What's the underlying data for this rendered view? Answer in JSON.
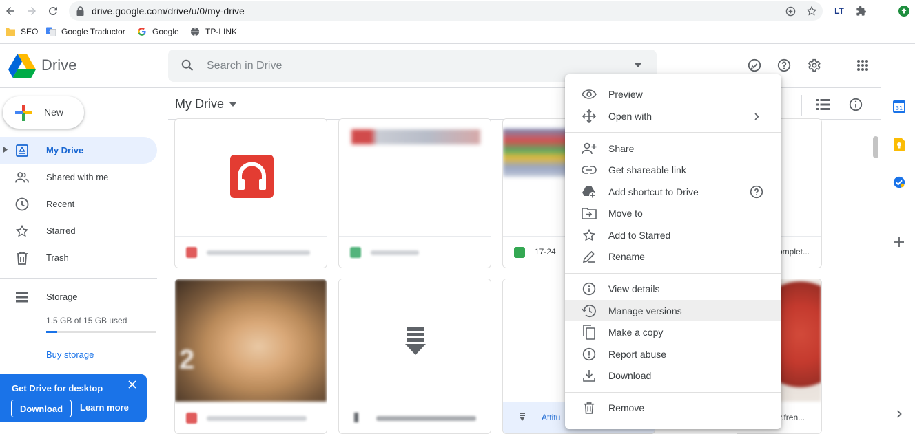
{
  "browser": {
    "url": "drive.google.com/drive/u/0/my-drive",
    "extension_badge": "LT",
    "bookmarks": [
      "SEO",
      "Google Traductor",
      "Google",
      "TP-LINK"
    ]
  },
  "header": {
    "app_name": "Drive",
    "search_placeholder": "Search in Drive"
  },
  "sidebar": {
    "new_label": "New",
    "items": [
      {
        "label": "My Drive",
        "active": true
      },
      {
        "label": "Shared with me"
      },
      {
        "label": "Recent"
      },
      {
        "label": "Starred"
      },
      {
        "label": "Trash"
      }
    ],
    "storage_label": "Storage",
    "storage_used": "1.5 GB of 15 GB used",
    "storage_fraction": 0.1,
    "buy_storage": "Buy storage"
  },
  "promo": {
    "title": "Get Drive for desktop",
    "download": "Download",
    "learn_more": "Learn more"
  },
  "main": {
    "title": "My Drive",
    "files_row1": [
      {
        "name": "",
        "icon_color": "#e05c5c"
      },
      {
        "name": "",
        "icon_color": "#53b47c"
      },
      {
        "name": "17-24",
        "icon_color": "#34a853"
      },
      {
        "name": "omplet...",
        "icon_color": ""
      }
    ],
    "files_row2": [
      {
        "name": "",
        "icon_color": "#e05c5c"
      },
      {
        "name": "",
        "icon_color": ""
      },
      {
        "name": "Attitu",
        "icon_color": ""
      },
      {
        "name": "v.fren...",
        "icon_color": ""
      }
    ]
  },
  "context_menu": {
    "items": [
      {
        "label": "Preview",
        "icon": "eye-icon"
      },
      {
        "label": "Open with",
        "icon": "move-arrows-icon"
      },
      {
        "label": "Share",
        "icon": "person-add-icon"
      },
      {
        "label": "Get shareable link",
        "icon": "link-icon"
      },
      {
        "label": "Add shortcut to Drive",
        "icon": "drive-shortcut-icon"
      },
      {
        "label": "Move to",
        "icon": "folder-move-icon"
      },
      {
        "label": "Add to Starred",
        "icon": "star-icon"
      },
      {
        "label": "Rename",
        "icon": "pencil-icon"
      },
      {
        "label": "View details",
        "icon": "info-icon"
      },
      {
        "label": "Manage versions",
        "icon": "history-icon"
      },
      {
        "label": "Make a copy",
        "icon": "copy-icon"
      },
      {
        "label": "Report abuse",
        "icon": "report-icon"
      },
      {
        "label": "Download",
        "icon": "download-icon"
      },
      {
        "label": "Remove",
        "icon": "trash-icon"
      }
    ],
    "highlighted": "Manage versions"
  },
  "colors": {
    "accent": "#1a73e8",
    "active_nav_bg": "#e8f0fe",
    "active_nav_text": "#1967d2",
    "menu_highlight": "#eeeeee"
  }
}
